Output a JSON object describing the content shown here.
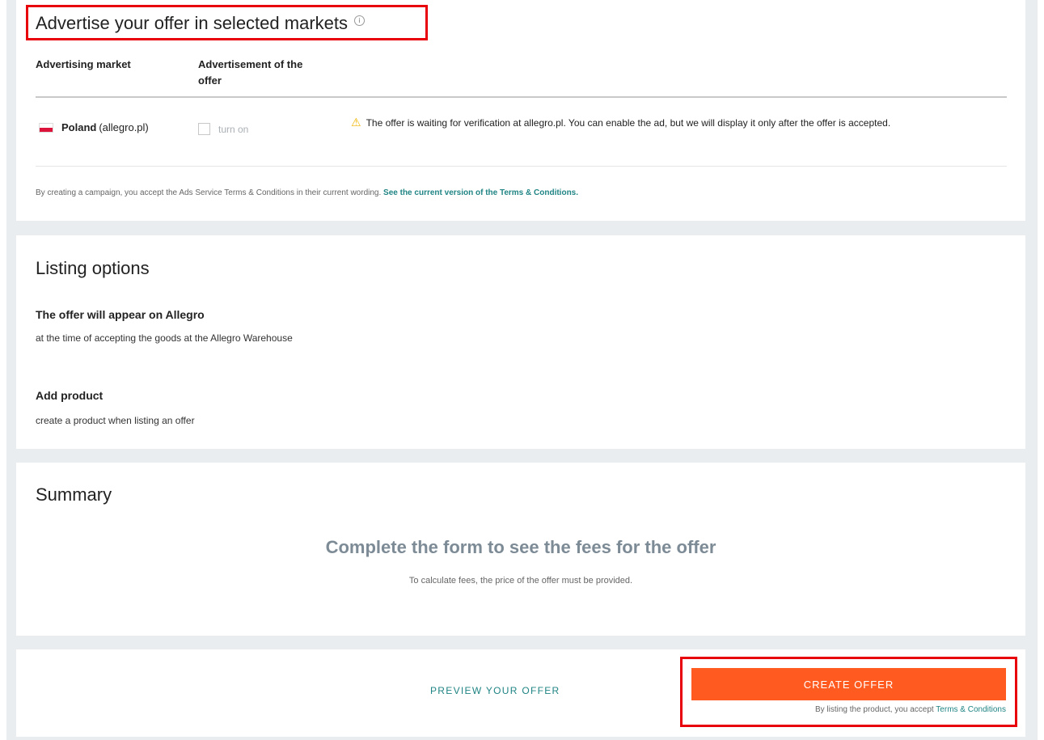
{
  "advertise": {
    "title": "Advertise your offer in selected markets",
    "info_icon": "i",
    "col_market": "Advertising market",
    "col_ad_line1": "Advertisement of the",
    "col_ad_line2": "offer",
    "market_country": "Poland",
    "market_site": "(allegro.pl)",
    "toggle_label": "turn on",
    "toggle_checked": false,
    "warning_icon": "⚠",
    "warning_text": "The offer is waiting for verification at allegro.pl. You can enable the ad, but we will display it only after the offer is accepted.",
    "terms_text": "By creating a campaign, you accept the Ads Service Terms & Conditions in their current wording.",
    "terms_link": "See the current version of the Terms & Conditions."
  },
  "listing": {
    "title": "Listing options",
    "appear_title": "The offer will appear on Allegro",
    "appear_text": "at the time of accepting the goods at the Allegro Warehouse",
    "product_title": "Add product",
    "product_text": "create a product when listing an offer"
  },
  "summary": {
    "title": "Summary",
    "headline": "Complete the form to see the fees for the offer",
    "subtext": "To calculate fees, the price of the offer must be provided."
  },
  "actions": {
    "preview_label": "PREVIEW YOUR OFFER",
    "create_label": "CREATE OFFER",
    "accept_text": "By listing the product, you accept",
    "accept_link": "Terms & Conditions"
  },
  "colors": {
    "accent": "#208484",
    "create_button": "#ff5a1f",
    "highlight": "#e8000b",
    "warning": "#f0b400"
  }
}
